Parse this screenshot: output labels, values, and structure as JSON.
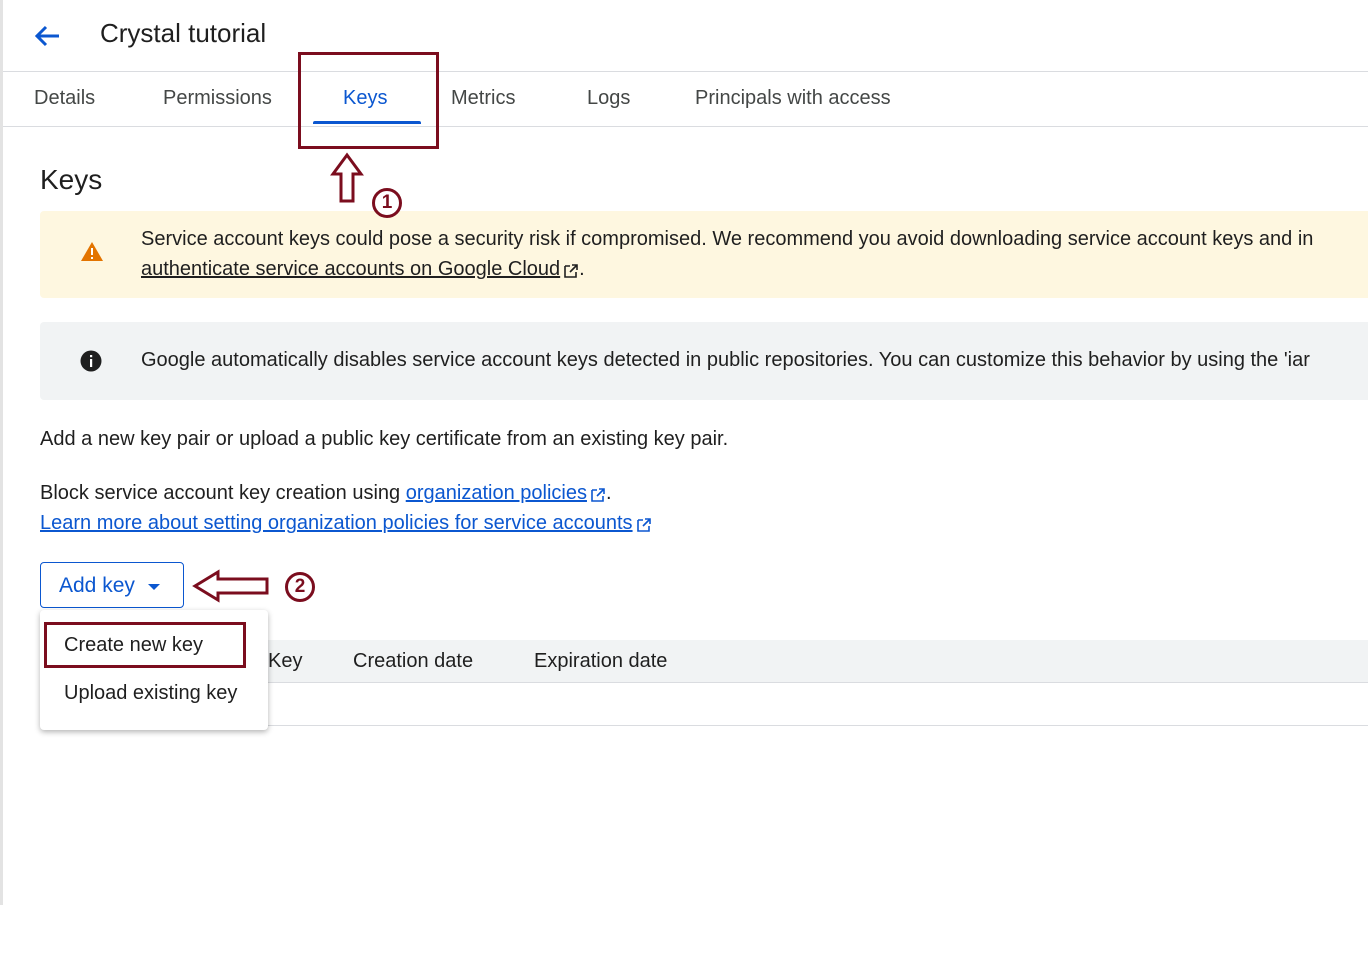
{
  "header": {
    "title": "Crystal tutorial"
  },
  "tabs": [
    {
      "label": "Details"
    },
    {
      "label": "Permissions"
    },
    {
      "label": "Keys",
      "active": true
    },
    {
      "label": "Metrics"
    },
    {
      "label": "Logs"
    },
    {
      "label": "Principals with access"
    }
  ],
  "section": {
    "title": "Keys"
  },
  "warning_banner": {
    "icon": "warning-icon",
    "line1": "Service account keys could pose a security risk if compromised. We recommend you avoid downloading service account keys and in",
    "link": "authenticate service accounts on Google Cloud",
    "suffix": "."
  },
  "info_banner": {
    "icon": "info-icon",
    "text": "Google automatically disables service account keys detected in public repositories. You can customize this behavior by using the 'iar"
  },
  "description": "Add a new key pair or upload a public key certificate from an existing key pair.",
  "policy": {
    "prefix": "Block service account key creation using ",
    "link": "organization policies",
    "suffix": ".",
    "learn_more": "Learn more about setting organization policies for service accounts"
  },
  "add_key_button": {
    "label": "Add key"
  },
  "dropdown": {
    "items": [
      "Create new key",
      "Upload existing key"
    ]
  },
  "table": {
    "columns": [
      "Key",
      "Creation date",
      "Expiration date"
    ]
  },
  "annotations": {
    "step1": "1",
    "step2": "2",
    "color": "#7b0d1e"
  },
  "colors": {
    "accent": "#0b57d0",
    "warning_bg": "#fef7e0",
    "info_bg": "#f1f3f4"
  }
}
